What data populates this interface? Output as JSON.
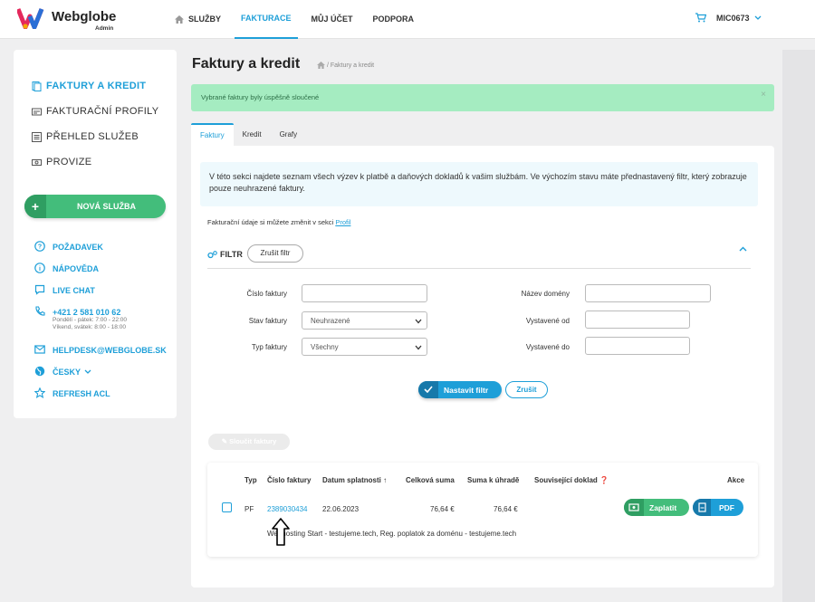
{
  "brand": {
    "name": "Webglobe",
    "sub": "Admin"
  },
  "nav": {
    "items": [
      {
        "label": "SLUŽBY"
      },
      {
        "label": "FAKTURACE"
      },
      {
        "label": "MŮJ ÚČET"
      },
      {
        "label": "PODPORA"
      }
    ],
    "user": "MIC0673",
    "accent": "#1e9fd8"
  },
  "sidebar": {
    "menu": [
      {
        "label": "FAKTURY A KREDIT"
      },
      {
        "label": "FAKTURAČNÍ PROFILY"
      },
      {
        "label": "PŘEHLED SLUŽEB"
      },
      {
        "label": "PROVIZE"
      }
    ],
    "new_service": "NOVÁ SLUŽBA",
    "help": {
      "request": "POŽADAVEK",
      "help": "NÁPOVĚDA",
      "chat": "LIVE CHAT",
      "phone": "+421 2 581 010 62",
      "phone_hours1": "Pondělí - pátek: 7:00 - 22:00",
      "phone_hours2": "Víkend, svátek: 8:00 - 18:00",
      "email": "HELPDESK@WEBGLOBE.SK",
      "lang": "ČESKY",
      "refresh": "REFRESH ACL"
    }
  },
  "page": {
    "title": "Faktury a kredit",
    "breadcrumb": "/ Faktury a kredit",
    "alert": "Vybrané faktury byly úspěšně sloučené",
    "alert_close": "×",
    "tabs": [
      {
        "label": "Faktury"
      },
      {
        "label": "Kredit"
      },
      {
        "label": "Grafy"
      }
    ],
    "info": "V této sekci najdete seznam všech výzev k platbě a daňových dokladů k vašim službám. Ve výchozím stavu máte přednastavený filtr, který zobrazuje pouze neuhrazené faktury.",
    "profil_text": "Fakturační údaje si můžete změnit v sekci ",
    "profil_link": "Profil"
  },
  "filter": {
    "title": "FILTR",
    "clear": "Zrušit filtr",
    "invoice_number_label": "Číslo faktury",
    "invoice_number_value": "",
    "state_label": "Stav faktury",
    "state_value": "Neuhrazené",
    "type_label": "Typ faktury",
    "type_value": "Všechny",
    "domain_label": "Název domény",
    "domain_value": "",
    "issued_from_label": "Vystavené od",
    "issued_from_value": "",
    "issued_to_label": "Vystavené do",
    "issued_to_value": "",
    "apply": "Nastavit filtr",
    "cancel": "Zrušit"
  },
  "merge_button": "Sloučit faktury",
  "table": {
    "headers": {
      "type": "Typ",
      "number": "Číslo faktury",
      "due": "Datum splatnosti",
      "total": "Celková suma",
      "to_pay": "Suma k úhradě",
      "related": "Související doklad",
      "actions": "Akce"
    },
    "rows": [
      {
        "type": "PF",
        "number": "2389030434",
        "due": "22.06.2023",
        "total": "76,64 €",
        "to_pay": "76,64 €",
        "description": "Webhosting Start - testujeme.tech, Reg. poplatok za doménu - testujeme.tech",
        "pay": "Zaplatit",
        "pdf": "PDF"
      }
    ]
  }
}
